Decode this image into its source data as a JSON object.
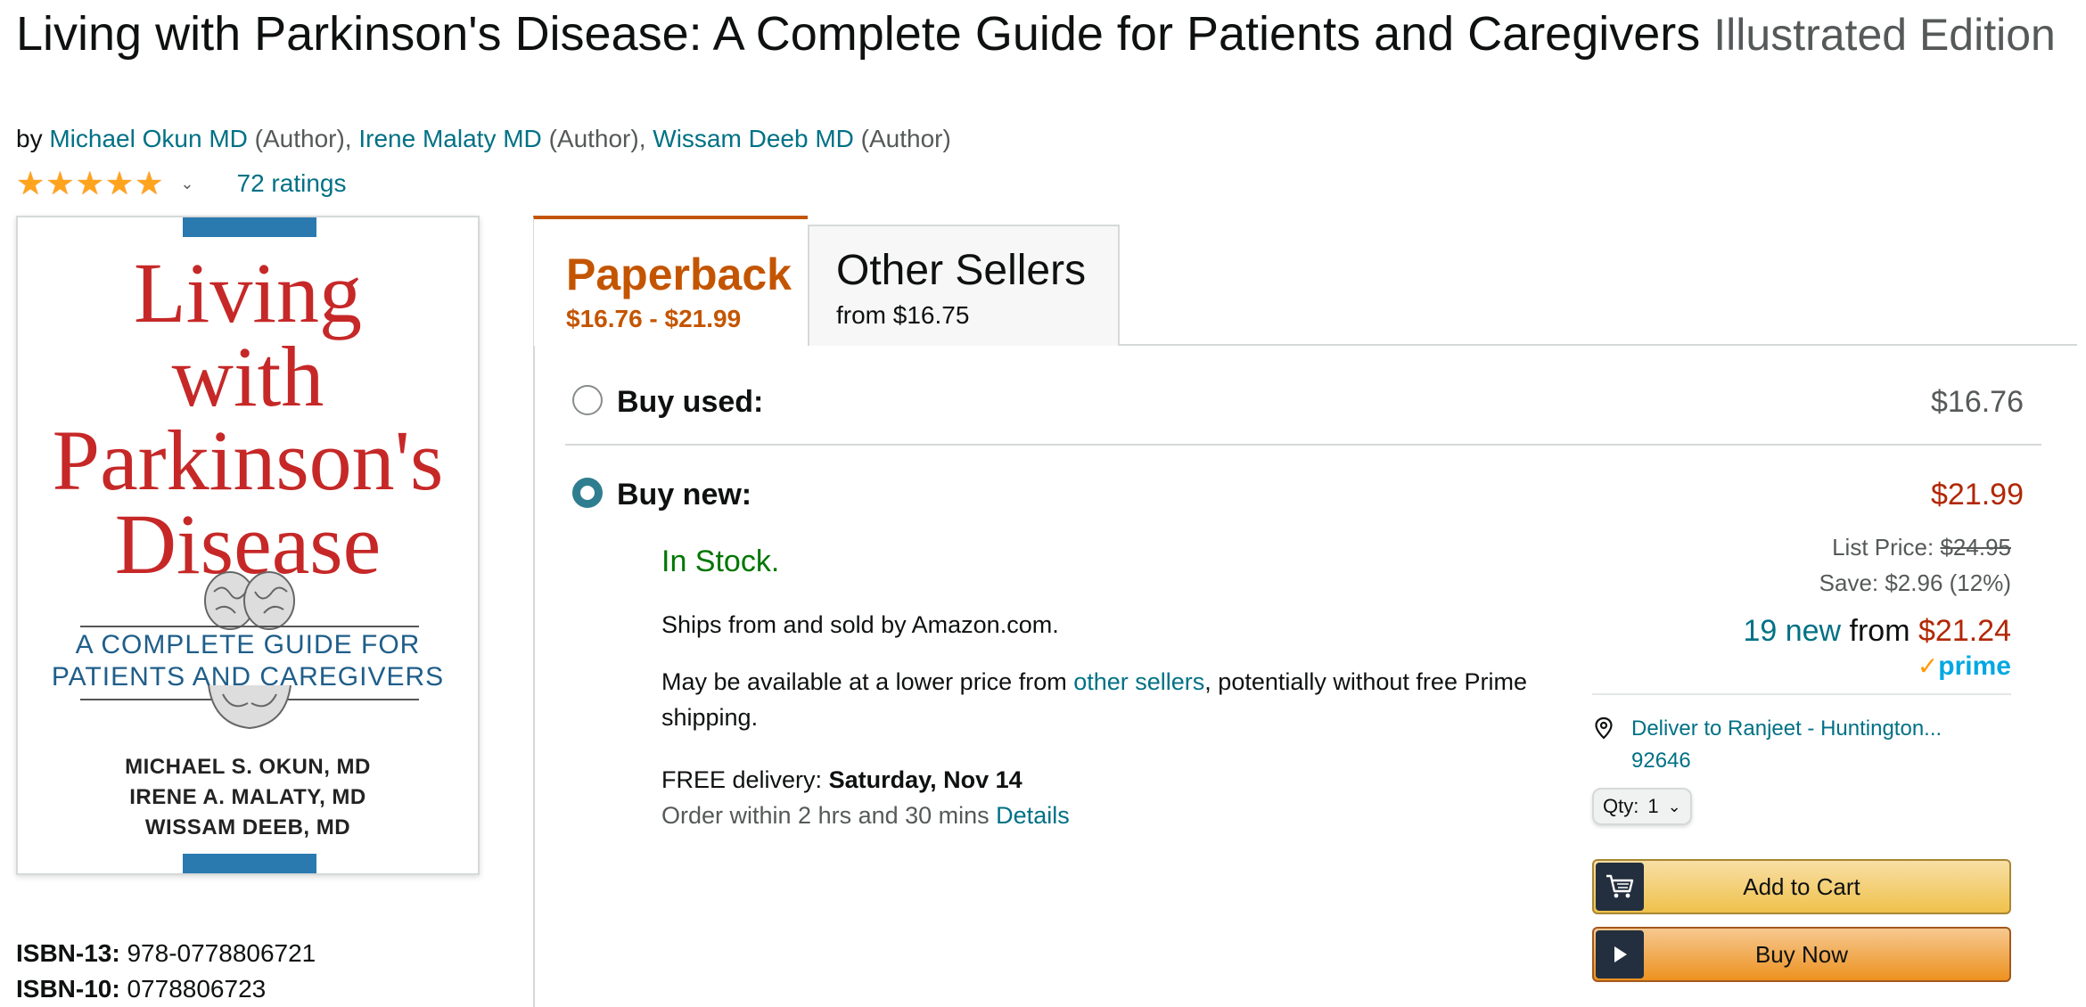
{
  "product": {
    "title": "Living with Parkinson's Disease: A Complete Guide for Patients and Caregivers",
    "edition": "Illustrated Edition",
    "by_label": "by",
    "authors": [
      {
        "name": "Michael Okun MD",
        "role": "(Author),"
      },
      {
        "name": "Irene Malaty MD",
        "role": "(Author),"
      },
      {
        "name": "Wissam Deeb MD",
        "role": "(Author)"
      }
    ],
    "stars": 5,
    "ratings_text": "72 ratings"
  },
  "cover": {
    "title_lines": [
      "Living",
      "with",
      "Parkinson's",
      "Disease"
    ],
    "subtitle_lines": [
      "A COMPLETE GUIDE FOR",
      "PATIENTS AND CAREGIVERS"
    ],
    "author_lines": [
      "MICHAEL S. OKUN, MD",
      "IRENE A. MALATY, MD",
      "WISSAM DEEB, MD"
    ]
  },
  "isbn": {
    "isbn13_label": "ISBN-13:",
    "isbn13": "978-0778806721",
    "isbn10_label": "ISBN-10:",
    "isbn10": "0778806723"
  },
  "tabs": {
    "paperback": {
      "name": "Paperback",
      "range": "$16.76 - $21.99"
    },
    "other": {
      "name": "Other Sellers",
      "from": "from $16.75"
    }
  },
  "buy_used": {
    "label": "Buy used:",
    "price": "$16.76"
  },
  "buy_new": {
    "label": "Buy new:",
    "price": "$21.99",
    "stock": "In Stock.",
    "ships": "Ships from and sold by Amazon.com.",
    "lower_pre": "May be available at a lower price from ",
    "lower_link": "other sellers",
    "lower_post": ", potentially without free Prime shipping.",
    "delivery_label": "FREE delivery: ",
    "delivery_date": "Saturday, Nov 14",
    "order_within": "Order within 2 hrs and 30 mins ",
    "details_link": "Details",
    "list_price_label": "List Price: ",
    "list_price": "$24.95",
    "save": "Save: $2.96 (12%)",
    "new_count": "19 new",
    "from_word": " from ",
    "from_price": "$21.24",
    "prime": "prime",
    "deliver_to": "Deliver to Ranjeet - Huntington...",
    "zip": "92646",
    "qty_label": "Qty:",
    "qty_value": "1",
    "add_to_cart": "Add to Cart",
    "buy_now": "Buy Now"
  },
  "colors": {
    "link": "#007185",
    "price_red": "#B12704",
    "tab_orange": "#C45500",
    "in_stock_green": "#007600",
    "star": "#FFA41C"
  },
  "icons": [
    "star-icon",
    "chevron-down-icon",
    "location-pin-icon",
    "cart-icon",
    "play-icon",
    "prime-check-icon",
    "brain-icon"
  ]
}
